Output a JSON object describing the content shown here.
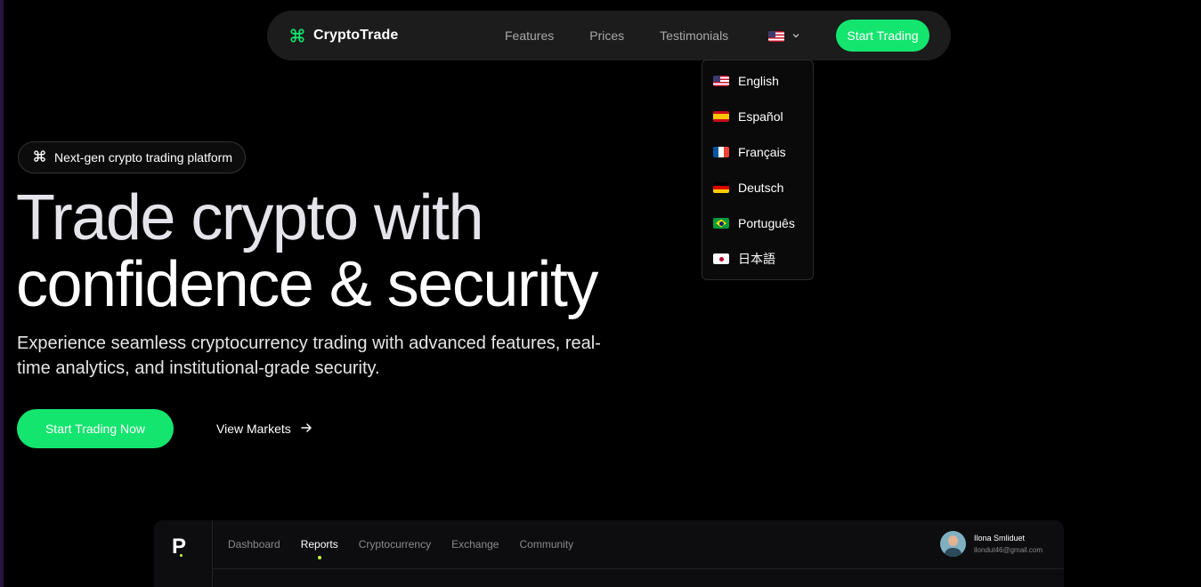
{
  "brand": {
    "name": "CryptoTrade",
    "icon": "command-icon"
  },
  "nav": {
    "links": [
      "Features",
      "Prices",
      "Testimonials"
    ],
    "language_current": "us-flag",
    "cta": "Start Trading"
  },
  "language_menu": [
    {
      "flag": "us",
      "label": "English"
    },
    {
      "flag": "es",
      "label": "Español"
    },
    {
      "flag": "fr",
      "label": "Français"
    },
    {
      "flag": "de",
      "label": "Deutsch"
    },
    {
      "flag": "br",
      "label": "Português"
    },
    {
      "flag": "jp",
      "label": "日本語"
    }
  ],
  "hero": {
    "badge": "Next-gen crypto trading platform",
    "title_line1": "Trade crypto with",
    "title_line2": "confidence & security",
    "subtitle": "Experience seamless cryptocurrency trading with advanced features, real-time analytics, and institutional-grade security.",
    "primary_cta": "Start Trading Now",
    "secondary_cta": "View Markets"
  },
  "dashboard": {
    "logo": "P",
    "nav": [
      "Dashboard",
      "Reports",
      "Cryptocurrency",
      "Exchange",
      "Community"
    ],
    "active": "Reports",
    "user": {
      "name": "Ilona Smliduet",
      "email": "ilondut46@gmail.com"
    }
  },
  "colors": {
    "accent": "#14e56e",
    "background": "#000000",
    "navbar": "#1c1c1c",
    "dot": "#c8ff3a"
  }
}
